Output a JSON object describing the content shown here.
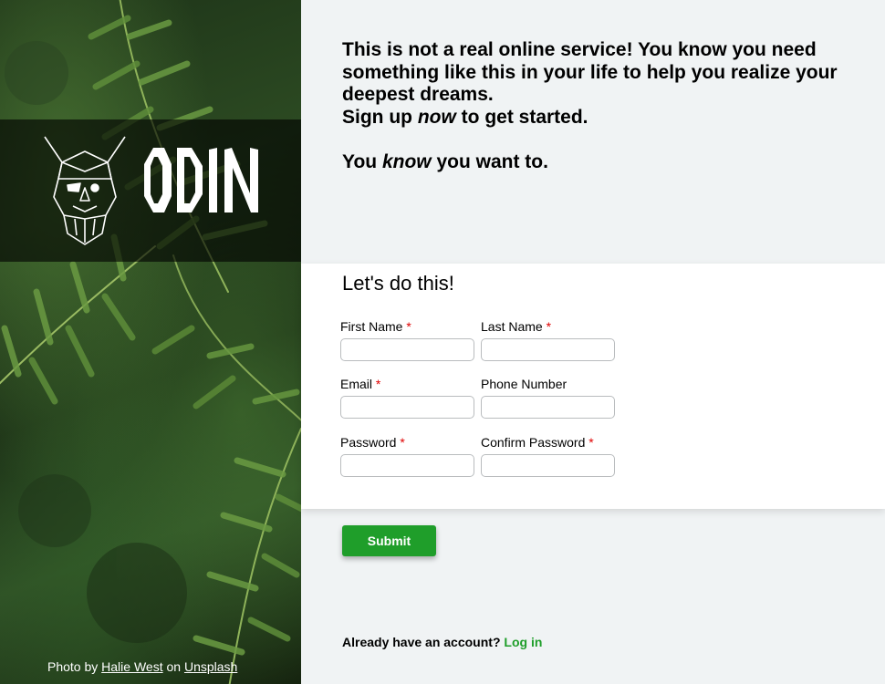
{
  "brand": {
    "name": "ODIN",
    "logo_icon": "viking-head-icon"
  },
  "intro": {
    "line1": "This is not a real online service! You know you need something like this in your life to help you realize your deepest dreams.",
    "line2_before": "Sign up ",
    "line2_em": "now",
    "line2_after": " to get started.",
    "line3_before": "You ",
    "line3_em": "know",
    "line3_after": " you want to."
  },
  "form": {
    "heading": "Let's do this!",
    "required_marker": "*",
    "fields": {
      "first_name": {
        "label": "First Name",
        "value": "",
        "required": true
      },
      "last_name": {
        "label": "Last Name",
        "value": "",
        "required": true
      },
      "email": {
        "label": "Email",
        "value": "",
        "required": true
      },
      "phone": {
        "label": "Phone Number",
        "value": "",
        "required": false
      },
      "password": {
        "label": "Password",
        "value": "",
        "required": true
      },
      "confirm_password": {
        "label": "Confirm Password",
        "value": "",
        "required": true
      }
    },
    "submit_label": "Submit"
  },
  "login": {
    "prompt": "Already have an account?",
    "link_label": "Log in"
  },
  "photo_credit": {
    "prefix": "Photo by",
    "author": "Halie West",
    "middle": "on",
    "source": "Unsplash"
  },
  "colors": {
    "accent_green": "#1f9e2a",
    "required_red": "#e00000",
    "page_background": "#f0f3f4",
    "card_background": "#ffffff"
  }
}
